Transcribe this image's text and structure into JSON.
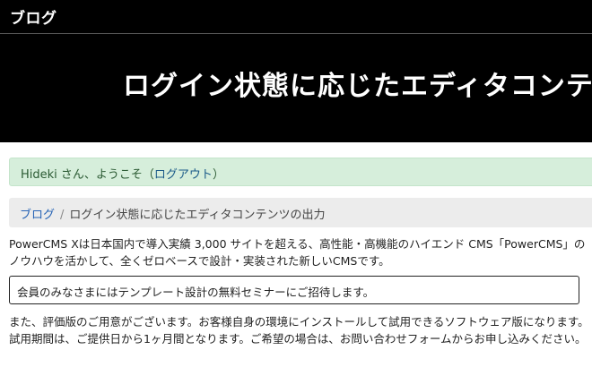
{
  "header": {
    "site_title": "ブログ"
  },
  "hero": {
    "title": "ログイン状態に応じたエディタコンテンツの出力"
  },
  "alert": {
    "greeting": "Hideki さん、ようこそ（",
    "logout_label": "ログアウト",
    "close_paren": "）"
  },
  "breadcrumb": {
    "home_label": "ブログ",
    "separator": "/",
    "current": "ログイン状態に応じたエディタコンテンツの出力"
  },
  "content": {
    "intro": "PowerCMS Xは日本国内で導入実績 3,000 サイトを超える、高性能・高機能のハイエンド CMS「PowerCMS」のノウハウを活かして、全くゼロベースで設計・実装された新しいCMSです。",
    "notice": "会員のみなさまにはテンプレート設計の無料セミナーにご招待します。",
    "trial": "また、評価版のご用意がございます。お客様自身の環境にインストールして試用できるソフトウェア版になります。試用期間は、ご提供日から1ヶ月間となります。ご希望の場合は、お問い合わせフォームからお申し込みください。"
  },
  "colors": {
    "header_bg": "#000000",
    "alert_bg": "#d6eedb",
    "breadcrumb_bg": "#ececec",
    "link": "#2663b5"
  }
}
